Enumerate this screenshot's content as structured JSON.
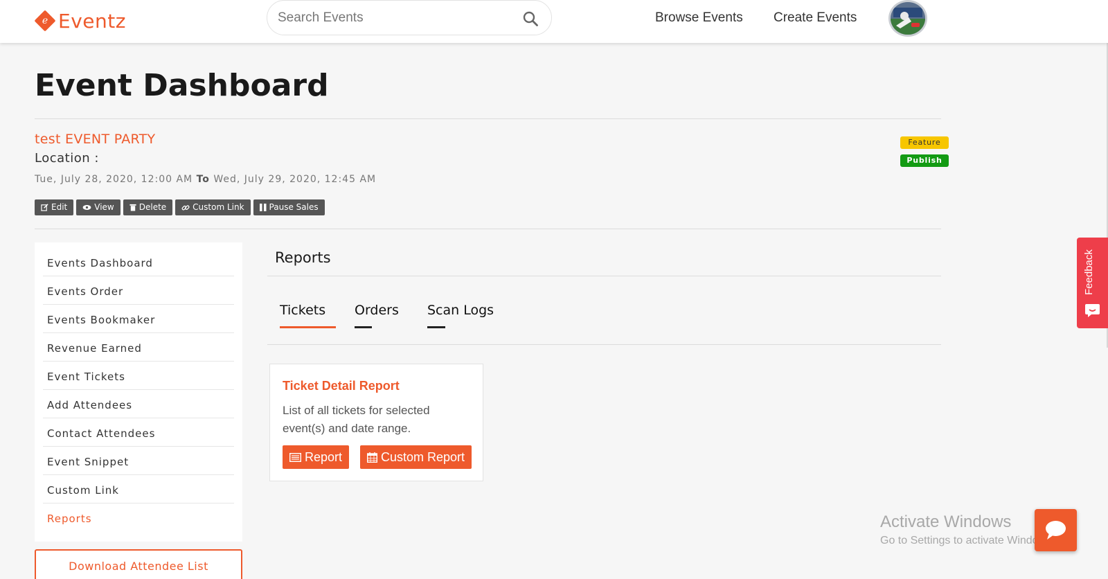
{
  "header": {
    "logo_text": "Eventz",
    "logo_letter": "e",
    "search_placeholder": "Search Events",
    "nav": {
      "browse": "Browse Events",
      "create": "Create Events"
    }
  },
  "page": {
    "title": "Event Dashboard"
  },
  "event": {
    "name": "test EVENT PARTY",
    "location_label": "Location :",
    "start": "Tue, July 28, 2020, 12:00 AM",
    "to_label": "To",
    "end": "Wed, July 29, 2020, 12:45 AM",
    "badges": {
      "feature": "Feature",
      "publish": "Publish"
    },
    "actions": {
      "edit": "Edit",
      "view": "View",
      "delete": "Delete",
      "custom_link": "Custom Link",
      "pause_sales": "Pause Sales"
    }
  },
  "sidebar": {
    "items": [
      {
        "label": "Events Dashboard"
      },
      {
        "label": "Events Order"
      },
      {
        "label": "Events Bookmaker"
      },
      {
        "label": "Revenue Earned"
      },
      {
        "label": "Event Tickets"
      },
      {
        "label": "Add Attendees"
      },
      {
        "label": "Contact Attendees"
      },
      {
        "label": "Event Snippet"
      },
      {
        "label": "Custom Link"
      },
      {
        "label": "Reports"
      }
    ],
    "active_item": "Reports",
    "download_label": "Download Attendee List"
  },
  "reports": {
    "title": "Reports",
    "tabs": [
      {
        "label": "Tickets"
      },
      {
        "label": "Orders"
      },
      {
        "label": "Scan Logs"
      }
    ],
    "active_tab": "Tickets",
    "card": {
      "title": "Ticket Detail Report",
      "description": "List of all tickets for selected event(s) and date range.",
      "report_button": "Report",
      "custom_report_button": "Custom Report"
    }
  },
  "feedback": {
    "label": "Feedback"
  },
  "watermark": {
    "line1": "Activate Windows",
    "line2": "Go to Settings to activate Windows."
  },
  "colors": {
    "accent": "#ee5a2c",
    "feature_badge": "#f7c600",
    "publish_badge": "#139b13",
    "action_button": "#555555",
    "feedback": "#ee3e4a"
  }
}
